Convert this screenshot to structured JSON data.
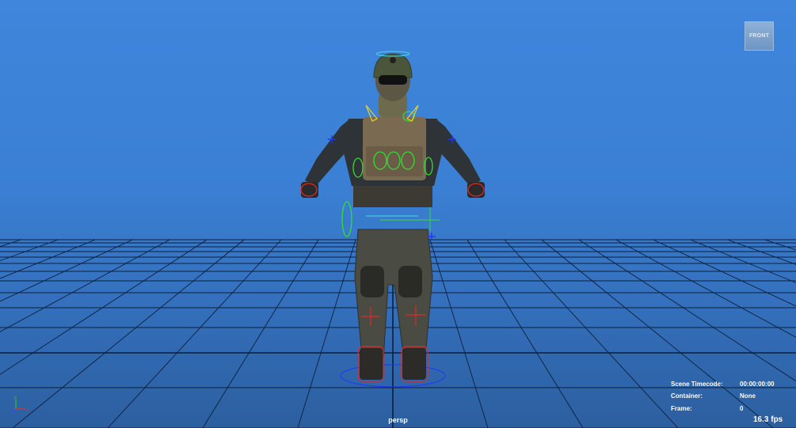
{
  "viewport": {
    "camera": "persp",
    "view_cube_label": "FRONT",
    "background_colors": [
      "#3f86dc",
      "#2c5f9f"
    ],
    "grid_color": "#0c1f3a"
  },
  "hud": {
    "rows": [
      {
        "label": "Scene Timecode:",
        "value": "00:00:00:00"
      },
      {
        "label": "Container:",
        "value": "None"
      },
      {
        "label": "Frame:",
        "value": "0"
      }
    ],
    "fps": "16.3 fps"
  },
  "axis_gizmo": {
    "x_label": "x",
    "y_label": "y",
    "x_color": "#e03030",
    "y_color": "#30c030",
    "z_color": "#3050ff"
  },
  "model": {
    "description_icon": "soldier-character-model",
    "control_colors": {
      "fk": "#33dd33",
      "ik": "#e02828",
      "pole": "#2233ff",
      "spine": "#44dddd"
    }
  }
}
